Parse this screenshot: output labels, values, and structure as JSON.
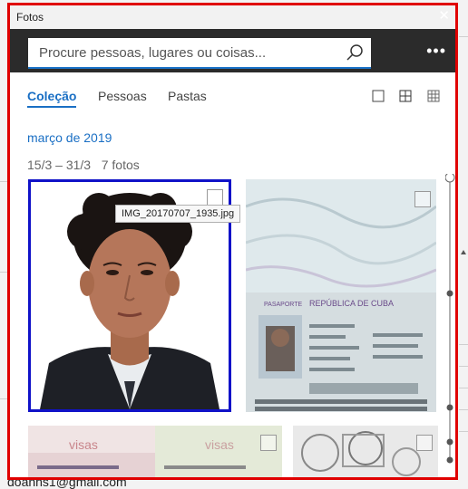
{
  "window": {
    "title": "Fotos"
  },
  "search": {
    "placeholder": "Procure pessoas, lugares ou coisas..."
  },
  "tabs": [
    {
      "label": "Coleção",
      "active": true
    },
    {
      "label": "Pessoas",
      "active": false
    },
    {
      "label": "Pastas",
      "active": false
    }
  ],
  "view_modes": [
    "large-tiles-icon",
    "medium-tiles-icon",
    "small-tiles-icon"
  ],
  "gallery": {
    "month_heading": "março de 2019",
    "date_range": "15/3 – 31/3",
    "photo_count": "7 fotos"
  },
  "tooltip": {
    "text": "IMG_20170707_1935.jpg"
  },
  "document": {
    "header_text": "REPÚBLICA DE CUBA",
    "passport_label": "PASAPORTE",
    "visa_text": "visas"
  },
  "background": {
    "email_fragment": "doanhs1@gmail.com"
  },
  "colors": {
    "accent": "#1a6fc4",
    "highlight_border": "#e00000",
    "selection_border": "#1012c8",
    "topbar": "#2b2b2b"
  }
}
